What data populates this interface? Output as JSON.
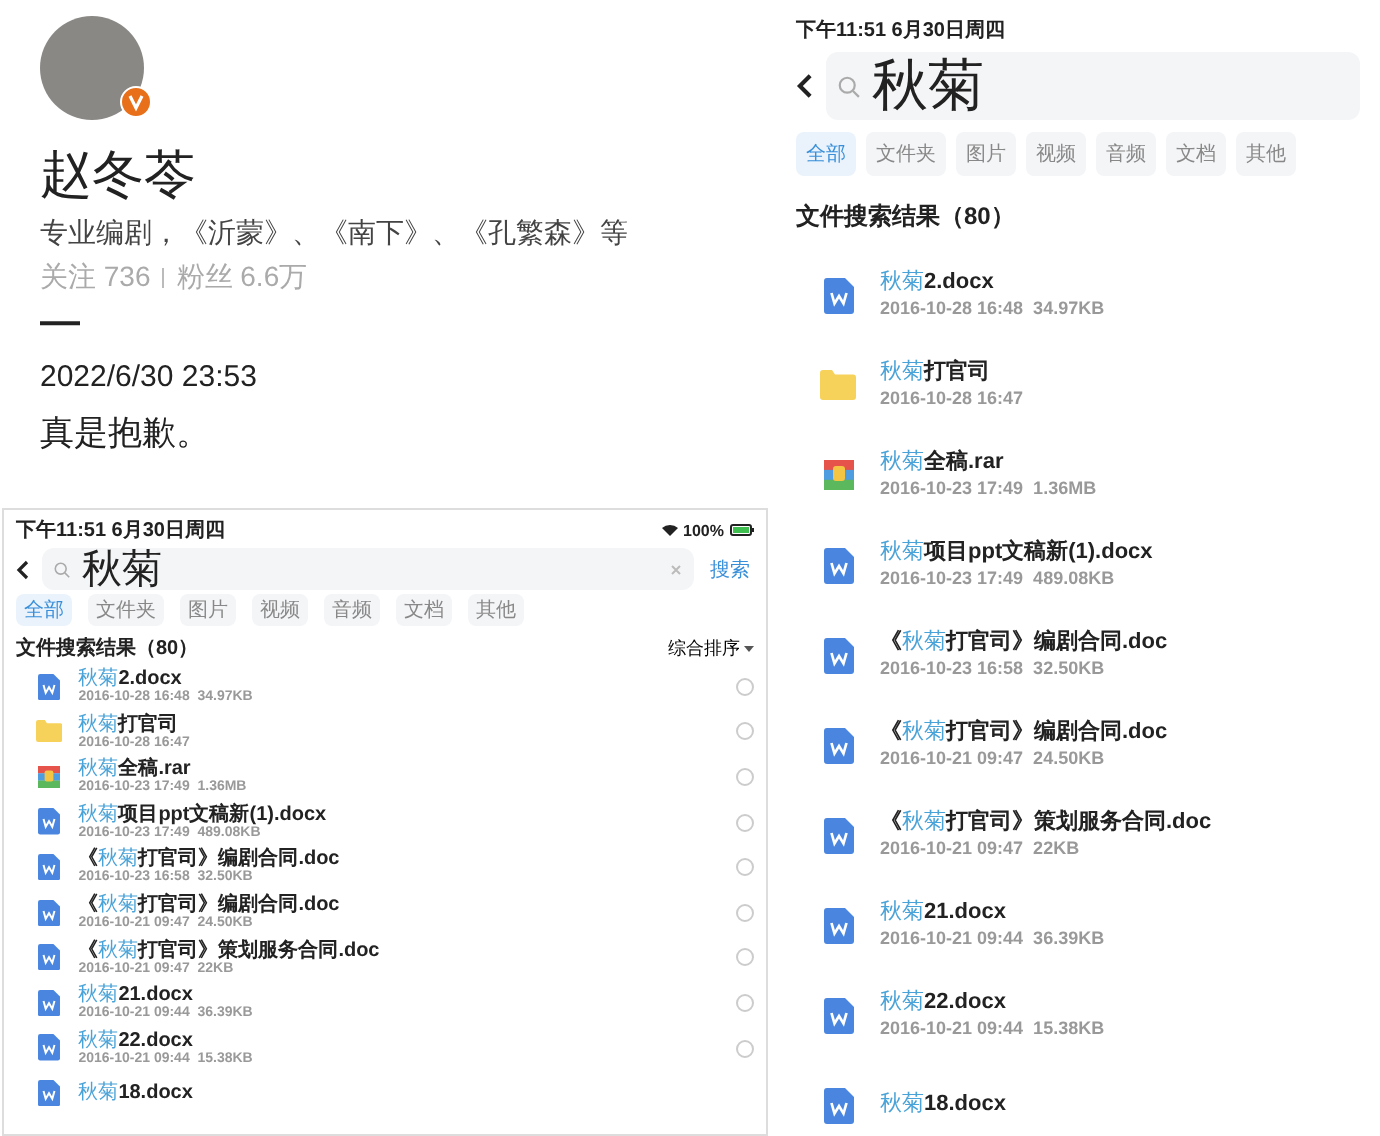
{
  "post": {
    "author": {
      "name": "赵冬苓",
      "verified": true,
      "bio": "专业编剧，《沂蒙》、《南下》、《孔繁森》等",
      "following": "关注 736",
      "followers": "粉丝 6.6万"
    },
    "mark": "—",
    "date": "2022/6/30 23:53",
    "text": "真是抱歉。",
    "screenshot": {
      "status_bar": {
        "time": "下午11:51  6月30日周四",
        "battery": "100%"
      },
      "search": {
        "value": "秋菊",
        "button": "搜索"
      },
      "tabs": [
        {
          "label": "全部",
          "selected": true
        },
        {
          "label": "文件夹",
          "selected": false
        },
        {
          "label": "图片",
          "selected": false
        },
        {
          "label": "视频",
          "selected": false
        },
        {
          "label": "音频",
          "selected": false
        },
        {
          "label": "文档",
          "selected": false
        },
        {
          "label": "其他",
          "selected": false
        }
      ],
      "results_title": "文件搜索结果（80）",
      "sort": "综合排序",
      "files": [
        {
          "kind": "doc",
          "name": [
            {
              "text": "秋菊",
              "highlight": true
            },
            {
              "text": "2.docx",
              "highlight": false
            }
          ],
          "meta": "2016-10-28 16:48  34.97KB",
          "selected": false
        },
        {
          "kind": "folder",
          "name": [
            {
              "text": "秋菊",
              "highlight": true
            },
            {
              "text": "打官司",
              "highlight": false
            }
          ],
          "meta": "2016-10-28 16:47",
          "selected": false
        },
        {
          "kind": "archive",
          "name": [
            {
              "text": "秋菊",
              "highlight": true
            },
            {
              "text": "全稿.rar",
              "highlight": false
            }
          ],
          "meta": "2016-10-23 17:49  1.36MB",
          "selected": false
        },
        {
          "kind": "doc",
          "name": [
            {
              "text": "秋菊",
              "highlight": true
            },
            {
              "text": "项目ppt文稿新(1).docx",
              "highlight": false
            }
          ],
          "meta": "2016-10-23 17:49  489.08KB",
          "selected": false
        },
        {
          "kind": "doc",
          "name": [
            {
              "text": "《",
              "highlight": false
            },
            {
              "text": "秋菊",
              "highlight": true
            },
            {
              "text": "打官司》编剧合同.doc",
              "highlight": false
            }
          ],
          "meta": "2016-10-23 16:58  32.50KB",
          "selected": false
        },
        {
          "kind": "doc",
          "name": [
            {
              "text": "《",
              "highlight": false
            },
            {
              "text": "秋菊",
              "highlight": true
            },
            {
              "text": "打官司》编剧合同.doc",
              "highlight": false
            }
          ],
          "meta": "2016-10-21 09:47  24.50KB",
          "selected": false
        },
        {
          "kind": "doc",
          "name": [
            {
              "text": "《",
              "highlight": false
            },
            {
              "text": "秋菊",
              "highlight": true
            },
            {
              "text": "打官司》策划服务合同.doc",
              "highlight": false
            }
          ],
          "meta": "2016-10-21 09:47  22KB",
          "selected": false
        },
        {
          "kind": "doc",
          "name": [
            {
              "text": "秋菊",
              "highlight": true
            },
            {
              "text": "21.docx",
              "highlight": false
            }
          ],
          "meta": "2016-10-21 09:44  36.39KB",
          "selected": false
        },
        {
          "kind": "doc",
          "name": [
            {
              "text": "秋菊",
              "highlight": true
            },
            {
              "text": "22.docx",
              "highlight": false
            }
          ],
          "meta": "2016-10-21 09:44  15.38KB",
          "selected": false
        },
        {
          "kind": "doc",
          "name": [
            {
              "text": "秋菊",
              "highlight": true
            },
            {
              "text": "18.docx",
              "highlight": false
            }
          ]
        }
      ]
    }
  },
  "file_search": {
    "status_bar": {
      "time": "下午11:51  6月30日周四"
    },
    "search": {
      "value": "秋菊"
    },
    "tabs": [
      {
        "label": "全部",
        "selected": true
      },
      {
        "label": "文件夹",
        "selected": false
      },
      {
        "label": "图片",
        "selected": false
      },
      {
        "label": "视频",
        "selected": false
      },
      {
        "label": "音频",
        "selected": false
      },
      {
        "label": "文档",
        "selected": false
      },
      {
        "label": "其他",
        "selected": false
      }
    ],
    "results_title": "文件搜索结果（80）",
    "files": [
      {
        "kind": "doc",
        "name": [
          {
            "text": "秋菊",
            "highlight": true
          },
          {
            "text": "2.docx",
            "highlight": false
          }
        ],
        "meta": "2016-10-28 16:48  34.97KB"
      },
      {
        "kind": "folder",
        "name": [
          {
            "text": "秋菊",
            "highlight": true
          },
          {
            "text": "打官司",
            "highlight": false
          }
        ],
        "meta": "2016-10-28 16:47"
      },
      {
        "kind": "archive",
        "name": [
          {
            "text": "秋菊",
            "highlight": true
          },
          {
            "text": "全稿.rar",
            "highlight": false
          }
        ],
        "meta": "2016-10-23 17:49  1.36MB"
      },
      {
        "kind": "doc",
        "name": [
          {
            "text": "秋菊",
            "highlight": true
          },
          {
            "text": "项目ppt文稿新(1).docx",
            "highlight": false
          }
        ],
        "meta": "2016-10-23 17:49  489.08KB"
      },
      {
        "kind": "doc",
        "name": [
          {
            "text": "《",
            "highlight": false
          },
          {
            "text": "秋菊",
            "highlight": true
          },
          {
            "text": "打官司》编剧合同.doc",
            "highlight": false
          }
        ],
        "meta": "2016-10-23 16:58  32.50KB"
      },
      {
        "kind": "doc",
        "name": [
          {
            "text": "《",
            "highlight": false
          },
          {
            "text": "秋菊",
            "highlight": true
          },
          {
            "text": "打官司》编剧合同.doc",
            "highlight": false
          }
        ],
        "meta": "2016-10-21 09:47  24.50KB"
      },
      {
        "kind": "doc",
        "name": [
          {
            "text": "《",
            "highlight": false
          },
          {
            "text": "秋菊",
            "highlight": true
          },
          {
            "text": "打官司》策划服务合同.doc",
            "highlight": false
          }
        ],
        "meta": "2016-10-21 09:47  22KB"
      },
      {
        "kind": "doc",
        "name": [
          {
            "text": "秋菊",
            "highlight": true
          },
          {
            "text": "21.docx",
            "highlight": false
          }
        ],
        "meta": "2016-10-21 09:44  36.39KB"
      },
      {
        "kind": "doc",
        "name": [
          {
            "text": "秋菊",
            "highlight": true
          },
          {
            "text": "22.docx",
            "highlight": false
          }
        ],
        "meta": "2016-10-21 09:44  15.38KB"
      },
      {
        "kind": "doc",
        "name": [
          {
            "text": "秋菊",
            "highlight": true
          },
          {
            "text": "18.docx",
            "highlight": false
          }
        ]
      }
    ]
  }
}
